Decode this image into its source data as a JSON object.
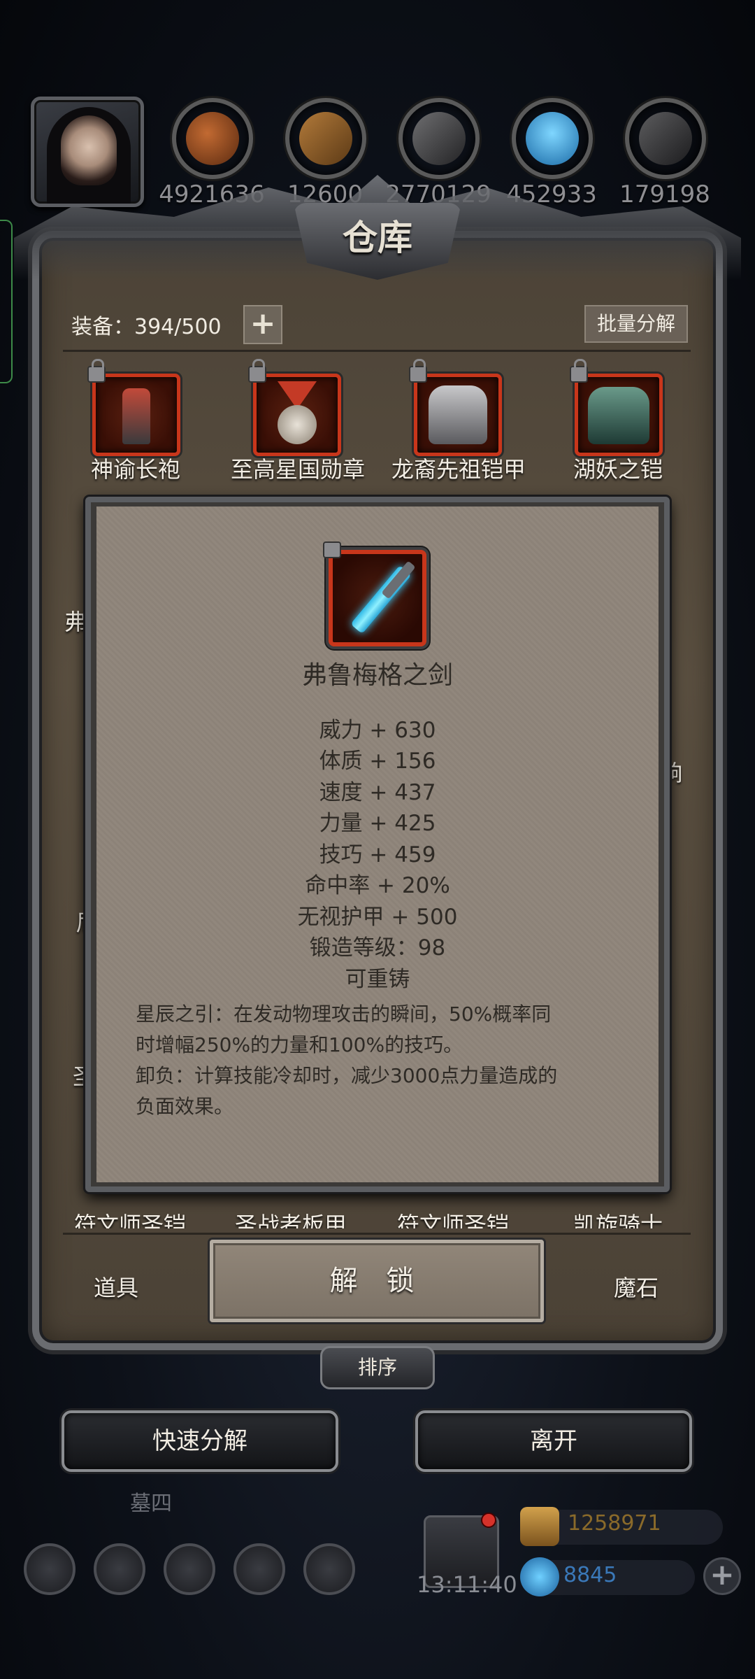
{
  "resources": {
    "values": [
      "4921636",
      "12600",
      "2770129",
      "452933",
      "179198"
    ]
  },
  "panel": {
    "title": "仓库",
    "equip_count": "装备：394/500",
    "plus": "+",
    "batch_decompose": "批量分解"
  },
  "items_row1": [
    {
      "name": "神谕长袍"
    },
    {
      "name": "至高星国勋章"
    },
    {
      "name": "龙裔先祖铠甲"
    },
    {
      "name": "湖妖之铠"
    }
  ],
  "obscured_left": [
    "弗",
    "尼",
    "圣"
  ],
  "obscured_right": [
    "响"
  ],
  "items_bottom_partial": [
    "符文师圣铠",
    "圣战者板甲",
    "符文师圣铠",
    "凯旋骑士"
  ],
  "detail": {
    "name": "弗鲁梅格之剑",
    "stats": [
      "威力 + 630",
      "体质 + 156",
      "速度 + 437",
      "力量 + 425",
      "技巧 + 459",
      "命中率 + 20%",
      "无视护甲 + 500",
      "锻造等级：98",
      "可重铸"
    ],
    "desc_lines": [
      "星辰之引：在发动物理攻击的瞬间，50%概率同",
      "时增幅250%的力量和100%的技巧。",
      "卸负：计算技能冷却时，减少3000点力量造成的",
      "负面效果。"
    ]
  },
  "tabs": {
    "left": "道具",
    "unlock": "解 锁",
    "right": "魔石"
  },
  "sort": "排序",
  "buttons": {
    "quick_decompose": "快速分解",
    "leave": "离开"
  },
  "background": {
    "time": "13:11:40",
    "gold": "1258971",
    "gems": "8845",
    "plus": "+",
    "partial_label": "墓四"
  }
}
